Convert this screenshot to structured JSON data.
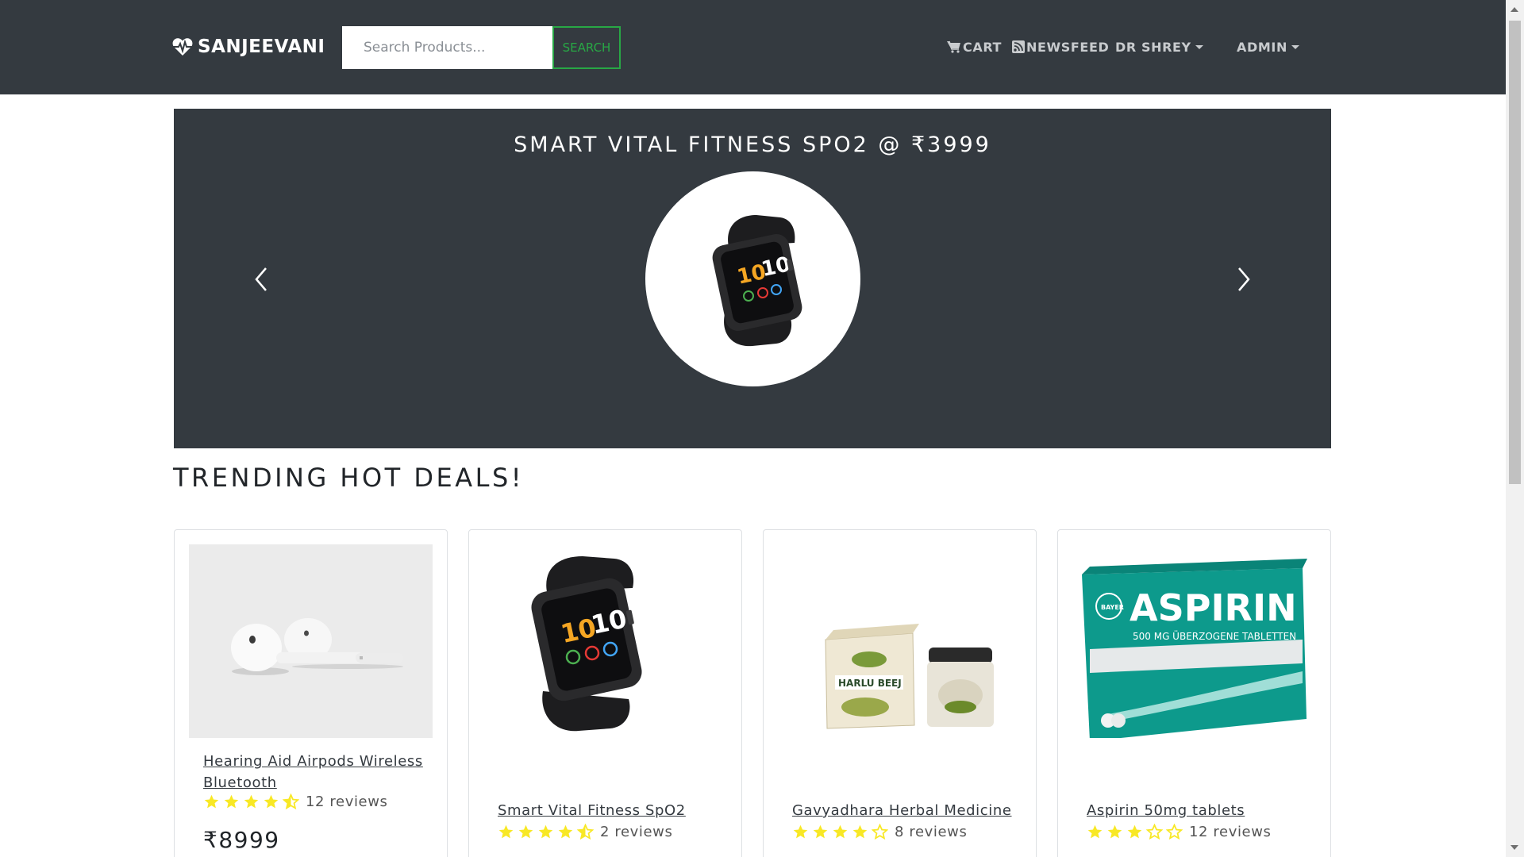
{
  "navbar": {
    "brand": "SANJEEVANI",
    "search_placeholder": "Search Products...",
    "search_button": "SEARCH",
    "cart": "CART",
    "newsfeed": "NEWSFEED",
    "user": "DR SHREY",
    "admin": "ADMIN"
  },
  "carousel": {
    "title": "SMART VITAL FITNESS SPO2 @ ₹3999"
  },
  "section": {
    "title": "TRENDING HOT DEALS!"
  },
  "colors": {
    "navbar_bg": "#343a40",
    "search_accent": "#28a745",
    "star": "#f8e825"
  },
  "products": [
    {
      "name": "Hearing Aid Airpods Wireless Bluetooth",
      "rating": 4.5,
      "reviews": "12 reviews",
      "price": "₹8999",
      "image": "airpods-image"
    },
    {
      "name": "Smart Vital Fitness SpO2",
      "rating": 4.5,
      "reviews": "2 reviews",
      "image": "smartwatch-image"
    },
    {
      "name": "Gavyadhara Herbal Medicine",
      "rating": 4,
      "reviews": "8 reviews",
      "image": "herbal-medicine-image"
    },
    {
      "name": "Aspirin 50mg tablets",
      "rating": 3,
      "reviews": "12 reviews",
      "image": "aspirin-box-image"
    }
  ],
  "product_images": {
    "aspirin_box_text": "ASPIRIN",
    "aspirin_box_subtext": "500 MG ÜBERZOGENE TABLETTEN",
    "aspirin_box_brand": "BAYER",
    "herbal_box_text": "HARLU BEEJ"
  }
}
